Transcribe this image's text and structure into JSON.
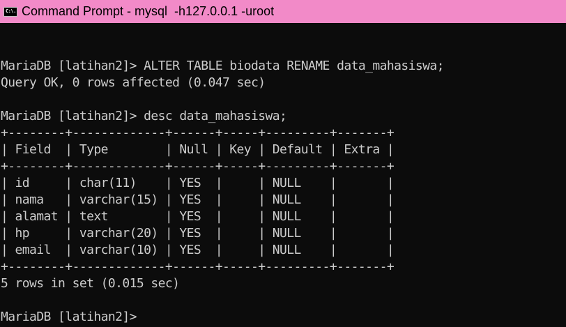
{
  "window": {
    "icon_label": "C:\\.",
    "title": "Command Prompt - mysql  -h127.0.0.1 -uroot"
  },
  "console": {
    "lines": [
      "",
      "MariaDB [latihan2]> ALTER TABLE biodata RENAME data_mahasiswa;",
      "Query OK, 0 rows affected (0.047 sec)",
      "",
      "MariaDB [latihan2]> desc data_mahasiswa;",
      "+--------+-------------+------+-----+---------+-------+",
      "| Field  | Type        | Null | Key | Default | Extra |",
      "+--------+-------------+------+-----+---------+-------+",
      "| id     | char(11)    | YES  |     | NULL    |       |",
      "| nama   | varchar(15) | YES  |     | NULL    |       |",
      "| alamat | text        | YES  |     | NULL    |       |",
      "| hp     | varchar(20) | YES  |     | NULL    |       |",
      "| email  | varchar(10) | YES  |     | NULL    |       |",
      "+--------+-------------+------+-----+---------+-------+",
      "5 rows in set (0.015 sec)",
      "",
      "MariaDB [latihan2]>"
    ]
  },
  "colors": {
    "titlebar": "#f28ac8",
    "console_bg": "#0c0c0c",
    "console_text": "#cccccc"
  }
}
